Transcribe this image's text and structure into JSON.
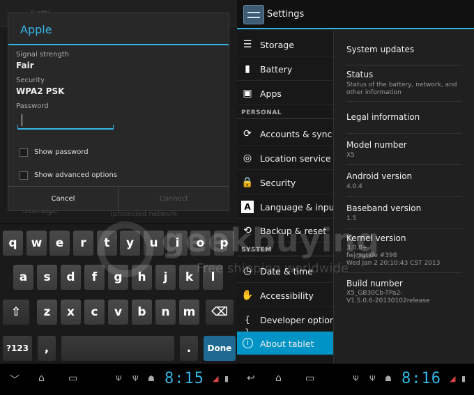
{
  "left_dialog": {
    "title": "Apple",
    "signal_label": "Signal strength",
    "signal_value": "Fair",
    "security_label": "Security",
    "security_value": "WPA2 PSK",
    "password_label": "Password",
    "password_value": "",
    "show_password_label": "Show password",
    "advanced_label": "Show advanced options",
    "cancel_label": "Cancel",
    "connect_label": "Connect"
  },
  "left_bg": {
    "title_fragment": "Setti",
    "storage_fragment": "Storage",
    "protected_fragment": "(protected network"
  },
  "keyboard": {
    "row1": [
      "q",
      "w",
      "e",
      "r",
      "t",
      "y",
      "u",
      "i",
      "o",
      "p"
    ],
    "row2": [
      "a",
      "s",
      "d",
      "f",
      "g",
      "h",
      "j",
      "k",
      "l"
    ],
    "row3": [
      "z",
      "x",
      "c",
      "v",
      "b",
      "n",
      "m"
    ],
    "shift_icon": "⇧",
    "delete_icon": "⌫",
    "symbols_label": "?123",
    "comma_label": ",",
    "period_label": ".",
    "done_label": "Done"
  },
  "left_nav": {
    "clock": "8:15"
  },
  "right_nav": {
    "clock": "8:16"
  },
  "settings": {
    "title": "Settings",
    "sections": {
      "personal": "PERSONAL",
      "system": "SYSTEM"
    },
    "menu": [
      {
        "label": "Storage",
        "icon": "storage-icon"
      },
      {
        "label": "Battery",
        "icon": "battery-icon"
      },
      {
        "label": "Apps",
        "icon": "apps-icon"
      },
      {
        "label": "Accounts & sync",
        "icon": "sync-icon"
      },
      {
        "label": "Location service",
        "icon": "location-icon"
      },
      {
        "label": "Security",
        "icon": "lock-icon"
      },
      {
        "label": "Language & inpu",
        "icon": "language-icon"
      },
      {
        "label": "Backup & reset",
        "icon": "backup-icon"
      },
      {
        "label": "Date & time",
        "icon": "clock-icon"
      },
      {
        "label": "Accessibility",
        "icon": "hand-icon"
      },
      {
        "label": "Developer option",
        "icon": "braces-icon"
      },
      {
        "label": "About tablet",
        "icon": "info-icon",
        "active": true
      }
    ],
    "about": {
      "system_updates": "System updates",
      "status_title": "Status",
      "status_sub": "Status of the battery, network, and other information",
      "legal": "Legal information",
      "model_title": "Model number",
      "model_value": "X5",
      "android_title": "Android version",
      "android_value": "4.0.4",
      "baseband_title": "Baseband version",
      "baseband_value": "1.5",
      "kernel_title": "Kernel version",
      "kernel_line1": "3.0.8+",
      "kernel_line2": "fwj@gtide #398",
      "kernel_line3": "Wed Jan 2 20:10:43 CST 2013",
      "build_title": "Build number",
      "build_line1": "X5_GB30Cb-TPa2-",
      "build_line2": "V1.5.0.6-20130102release"
    }
  },
  "watermark": {
    "brand": "geekbuying",
    "tagline": "Free shipping worldwide"
  },
  "colors": {
    "accent": "#33b5e5",
    "active_menu": "#0093c6"
  }
}
